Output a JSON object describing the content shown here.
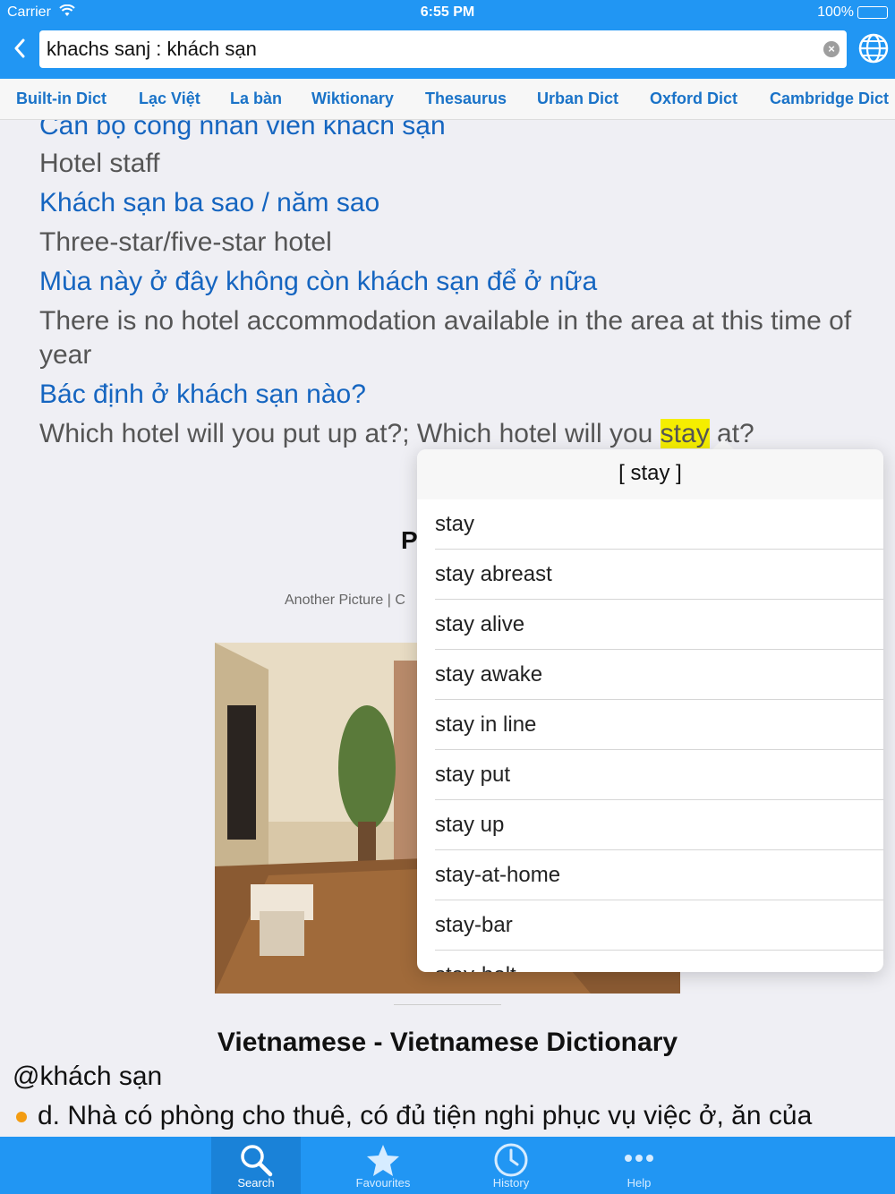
{
  "status_bar": {
    "carrier": "Carrier",
    "time": "6:55 PM",
    "battery": "100%"
  },
  "search": {
    "value": "khachs sanj : khách sạn"
  },
  "tabs": [
    "Built-in Dict",
    "Lạc Việt",
    "La bàn",
    "Wiktionary",
    "Thesaurus",
    "Urban Dict",
    "Oxford Dict",
    "Cambridge Dict"
  ],
  "examples": [
    {
      "vi": "Cán bộ công nhân viên khách sạn",
      "en": "Hotel staff"
    },
    {
      "vi": "Khách sạn ba sao / năm sao",
      "en": "Three-star/five-star hotel"
    },
    {
      "vi": "Mùa này ở đây không còn khách sạn để ở nữa",
      "en": "There is no hotel accommodation available in the area at this time of year"
    },
    {
      "vi": "Bác định ở khách sạn nào?",
      "en_before": "Which hotel will you put up at?; Which hotel will you ",
      "en_highlight": "stay",
      "en_after": " at?"
    }
  ],
  "picture_section": {
    "heading": "P",
    "links": "Another Picture  |  C"
  },
  "dictionary_section": {
    "title": "Vietnamese - Vietnamese Dictionary",
    "word": "@khách sạn",
    "definition": "d. Nhà có phòng cho thuê, có đủ tiện nghi phục vụ việc ở, ăn của"
  },
  "popover": {
    "title": "[ stay ]",
    "items": [
      "stay",
      "stay abreast",
      "stay alive",
      "stay awake",
      "stay in line",
      "stay put",
      "stay up",
      "stay-at-home",
      "stay-bar",
      "stay-bolt"
    ]
  },
  "bottom_bar": [
    {
      "label": "Search",
      "icon": "search-icon",
      "active": true
    },
    {
      "label": "Favourites",
      "icon": "star-icon",
      "active": false
    },
    {
      "label": "History",
      "icon": "clock-icon",
      "active": false
    },
    {
      "label": "Help",
      "icon": "more-icon",
      "active": false
    }
  ],
  "colors": {
    "primary": "#2196f3",
    "link_blue": "#1565c0",
    "highlight": "#f5ee00",
    "bullet": "#f39c12"
  }
}
